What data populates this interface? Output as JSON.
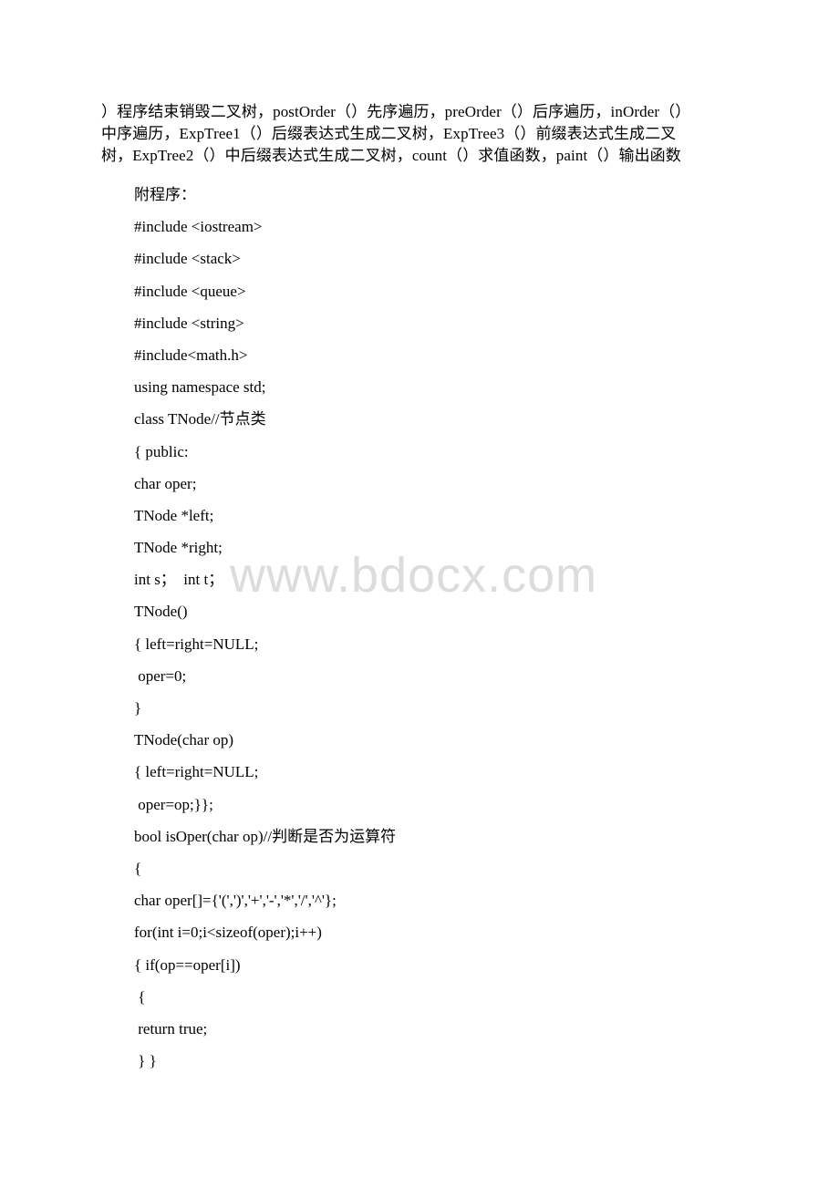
{
  "document": {
    "intro_lines": [
      "）程序结束销毁二叉树，postOrder（）先序遍历，preOrder（）后序遍历，inOrder（）",
      "中序遍历，ExpTree1（）后缀表达式生成二叉树，ExpTree3（）前缀表达式生成二叉",
      "树，ExpTree2（）中后缀表达式生成二叉树，count（）求值函数，paint（）输出函数"
    ],
    "code_lines": [
      "附程序：",
      "#include <iostream>",
      "#include <stack>",
      "#include <queue>",
      "#include <string>",
      "#include<math.h>",
      "using namespace std;",
      "class TNode//节点类",
      "{ public:",
      "char oper;",
      "TNode *left;",
      "TNode *right;",
      "int s；  int t；",
      "TNode()",
      "{ left=right=NULL;",
      " oper=0;",
      "}",
      "TNode(char op)",
      "{ left=right=NULL;",
      " oper=op;}};",
      "bool isOper(char op)//判断是否为运算符",
      "{",
      "char oper[]={'(',')','+','-','*','/','^'};",
      "for(int i=0;i<sizeof(oper);i++)",
      "{ if(op==oper[i])",
      " {",
      " return true;",
      " } }"
    ],
    "watermark": "www.bdocx.com"
  }
}
